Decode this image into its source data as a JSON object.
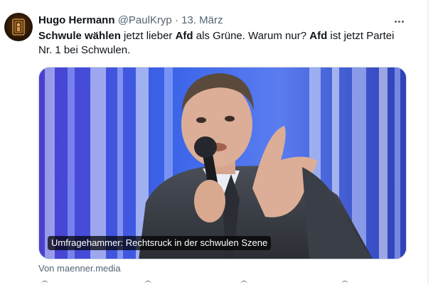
{
  "tweet": {
    "author_name": "Hugo Hermann",
    "handle": "@PaulKryp",
    "separator": "·",
    "date": "13. März",
    "text_parts": [
      {
        "text": "Schwule wählen",
        "bold": true
      },
      {
        "text": " jetzt lieber ",
        "bold": false
      },
      {
        "text": "Afd",
        "bold": true
      },
      {
        "text": " als Grüne. Warum nur? ",
        "bold": false
      },
      {
        "text": "Afd",
        "bold": true
      },
      {
        "text": " ist jetzt Partei Nr. 1 bei Schwulen.",
        "bold": false
      }
    ]
  },
  "card": {
    "caption": "Umfragehammer: Rechtsruck in der schwulen Szene",
    "source": "Von maenner.media"
  },
  "icons": {
    "more": "more-dots-icon",
    "avatar": "avatar"
  },
  "colors": {
    "text": "#0f1419",
    "secondary": "#536471",
    "border": "#cfd9de"
  }
}
